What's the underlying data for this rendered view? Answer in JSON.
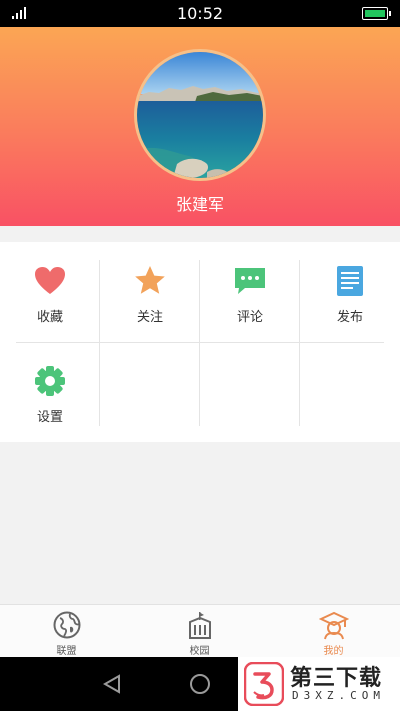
{
  "status_bar": {
    "time": "10:52",
    "battery_color": "#22c55e"
  },
  "profile": {
    "name": "张建军"
  },
  "menu": {
    "items": [
      {
        "label": "收藏",
        "icon": "heart-icon",
        "color": "#ef6b6b"
      },
      {
        "label": "关注",
        "icon": "star-icon",
        "color": "#f2a25a"
      },
      {
        "label": "评论",
        "icon": "chat-bubble-icon",
        "color": "#4cc47a"
      },
      {
        "label": "发布",
        "icon": "document-icon",
        "color": "#4aa7e0"
      },
      {
        "label": "设置",
        "icon": "gear-icon",
        "color": "#4cc47a"
      }
    ]
  },
  "tabbar": {
    "tabs": [
      {
        "label": "联盟",
        "icon": "globe-icon"
      },
      {
        "label": "校园",
        "icon": "school-building-icon"
      },
      {
        "label": "我的",
        "icon": "graduate-icon",
        "active": true
      }
    ],
    "active_color": "#e98a4f"
  },
  "watermark": {
    "title": "第三下载",
    "subtitle": "D3XZ.COM"
  }
}
